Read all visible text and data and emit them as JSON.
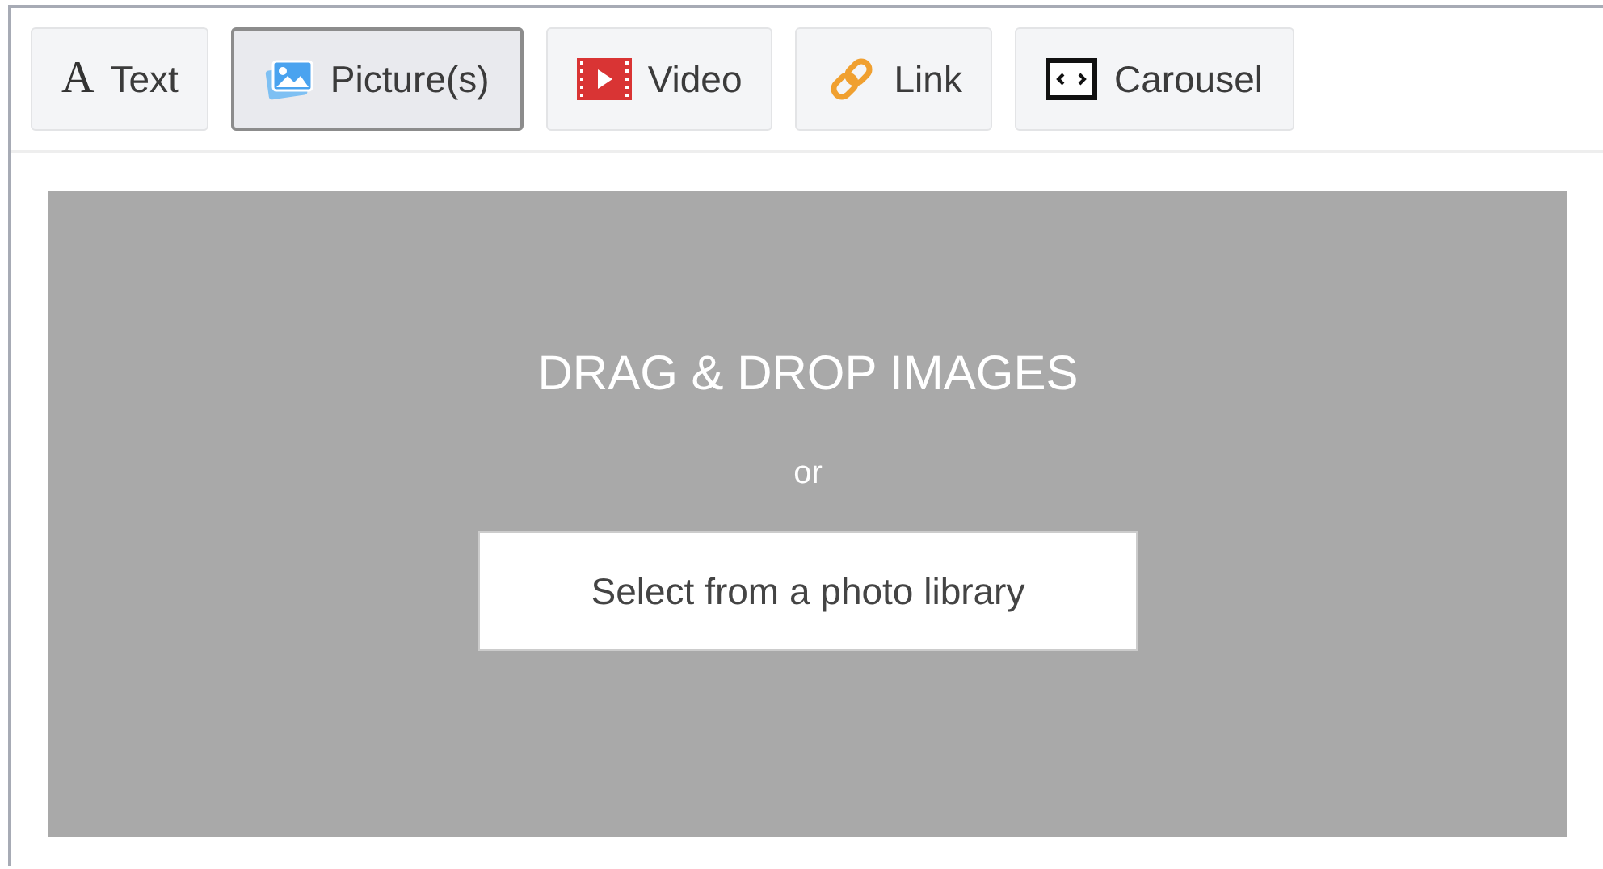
{
  "toolbar": [
    {
      "kind": "text",
      "icon_char": "A",
      "label": "Text",
      "selected": false
    },
    {
      "kind": "picture",
      "label": "Picture(s)",
      "selected": true
    },
    {
      "kind": "video",
      "label": "Video",
      "selected": false
    },
    {
      "kind": "link",
      "label": "Link",
      "selected": false
    },
    {
      "kind": "carousel",
      "label": "Carousel",
      "selected": false
    }
  ],
  "dropzone": {
    "heading": "DRAG & DROP IMAGES",
    "separator": "or",
    "button": "Select from a photo library"
  }
}
